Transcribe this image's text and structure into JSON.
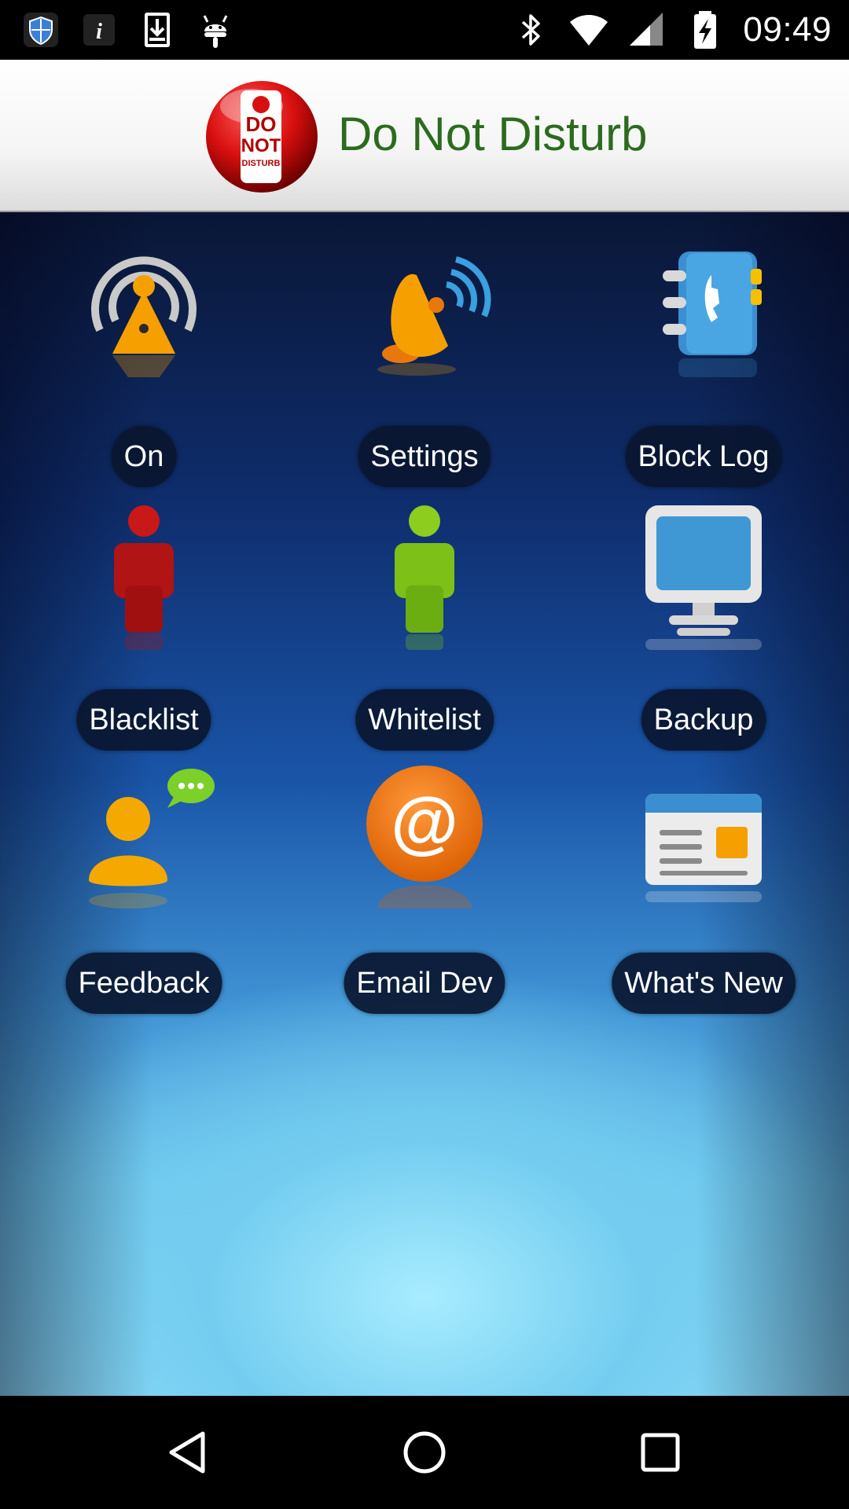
{
  "status_bar": {
    "time": "09:49",
    "left_icons": [
      "shield-icon",
      "info-icon",
      "download-icon",
      "android-icon"
    ],
    "right_icons": [
      "bluetooth-icon",
      "wifi-icon",
      "cell-signal-icon",
      "battery-charging-icon"
    ]
  },
  "app": {
    "title": "Do Not Disturb",
    "logo_text": [
      "DO",
      "NOT",
      "DISTURB"
    ]
  },
  "grid": [
    {
      "label": "On",
      "icon": "antenna-icon"
    },
    {
      "label": "Settings",
      "icon": "satellite-dish-icon"
    },
    {
      "label": "Block Log",
      "icon": "phonebook-icon"
    },
    {
      "label": "Blacklist",
      "icon": "red-person-icon"
    },
    {
      "label": "Whitelist",
      "icon": "green-person-icon"
    },
    {
      "label": "Backup",
      "icon": "monitor-icon"
    },
    {
      "label": "Feedback",
      "icon": "chat-person-icon"
    },
    {
      "label": "Email Dev",
      "icon": "at-sign-icon"
    },
    {
      "label": "What's New",
      "icon": "news-window-icon"
    }
  ],
  "nav": [
    "back-icon",
    "home-icon",
    "recents-icon"
  ],
  "colors": {
    "title_green": "#2c6b1e",
    "label_bg": "#0a1630",
    "accent_orange": "#f5a000"
  }
}
